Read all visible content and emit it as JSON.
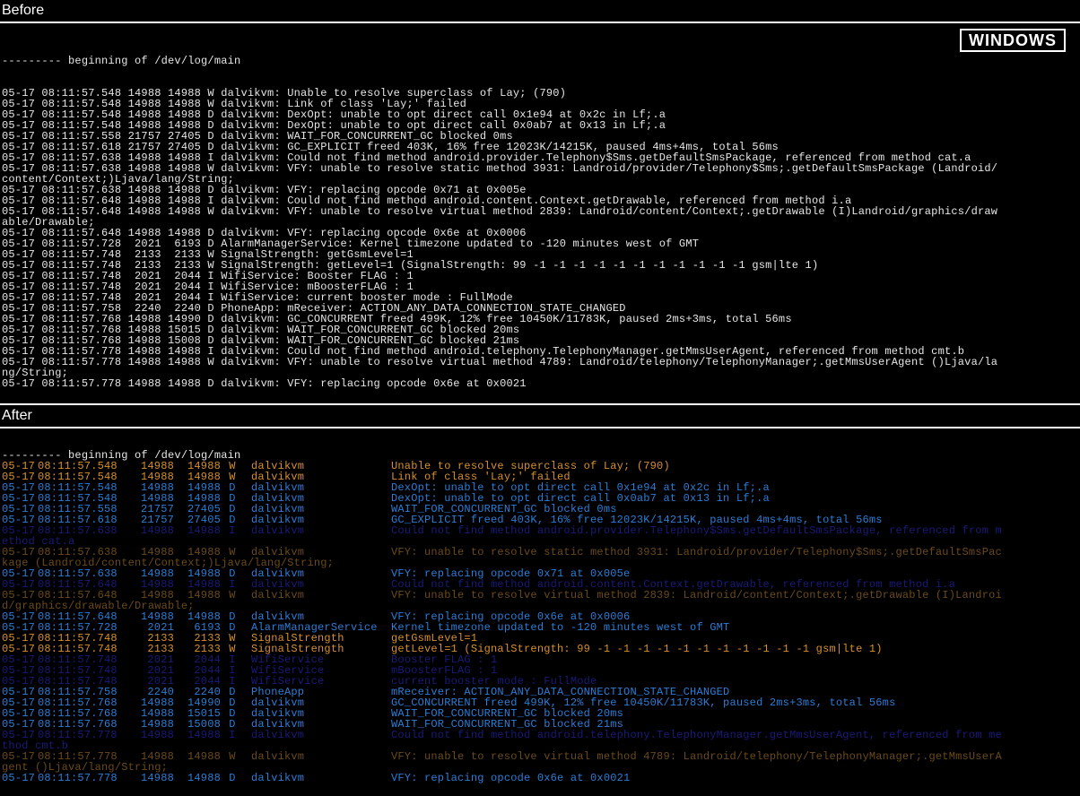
{
  "badge": "WINDOWS",
  "labels": {
    "before": "Before",
    "after": "After"
  },
  "begin_line": "--------- beginning of /dev/log/main",
  "before_lines": [
    "05-17 08:11:57.548 14988 14988 W dalvikvm: Unable to resolve superclass of Lay; (790)",
    "05-17 08:11:57.548 14988 14988 W dalvikvm: Link of class 'Lay;' failed",
    "05-17 08:11:57.548 14988 14988 D dalvikvm: DexOpt: unable to opt direct call 0x1e94 at 0x2c in Lf;.a",
    "05-17 08:11:57.548 14988 14988 D dalvikvm: DexOpt: unable to opt direct call 0x0ab7 at 0x13 in Lf;.a",
    "05-17 08:11:57.558 21757 27405 D dalvikvm: WAIT_FOR_CONCURRENT_GC blocked 0ms",
    "05-17 08:11:57.618 21757 27405 D dalvikvm: GC_EXPLICIT freed 403K, 16% free 12023K/14215K, paused 4ms+4ms, total 56ms",
    "05-17 08:11:57.638 14988 14988 I dalvikvm: Could not find method android.provider.Telephony$Sms.getDefaultSmsPackage, referenced from method cat.a",
    "05-17 08:11:57.638 14988 14988 W dalvikvm: VFY: unable to resolve static method 3931: Landroid/provider/Telephony$Sms;.getDefaultSmsPackage (Landroid/",
    "content/Context;)Ljava/lang/String;",
    "05-17 08:11:57.638 14988 14988 D dalvikvm: VFY: replacing opcode 0x71 at 0x005e",
    "05-17 08:11:57.648 14988 14988 I dalvikvm: Could not find method android.content.Context.getDrawable, referenced from method i.a",
    "05-17 08:11:57.648 14988 14988 W dalvikvm: VFY: unable to resolve virtual method 2839: Landroid/content/Context;.getDrawable (I)Landroid/graphics/draw",
    "able/Drawable;",
    "05-17 08:11:57.648 14988 14988 D dalvikvm: VFY: replacing opcode 0x6e at 0x0006",
    "05-17 08:11:57.728  2021  6193 D AlarmManagerService: Kernel timezone updated to -120 minutes west of GMT",
    "05-17 08:11:57.748  2133  2133 W SignalStrength: getGsmLevel=1",
    "05-17 08:11:57.748  2133  2133 W SignalStrength: getLevel=1 (SignalStrength: 99 -1 -1 -1 -1 -1 -1 -1 -1 -1 -1 -1 gsm|lte 1)",
    "05-17 08:11:57.748  2021  2044 I WifiService: Booster FLAG : 1",
    "05-17 08:11:57.748  2021  2044 I WifiService: mBoosterFLAG : 1",
    "05-17 08:11:57.748  2021  2044 I WifiService: current booster mode : FullMode",
    "05-17 08:11:57.758  2240  2240 D PhoneApp: mReceiver: ACTION_ANY_DATA_CONNECTION_STATE_CHANGED",
    "05-17 08:11:57.768 14988 14990 D dalvikvm: GC_CONCURRENT freed 499K, 12% free 10450K/11783K, paused 2ms+3ms, total 56ms",
    "05-17 08:11:57.768 14988 15015 D dalvikvm: WAIT_FOR_CONCURRENT_GC blocked 20ms",
    "05-17 08:11:57.768 14988 15008 D dalvikvm: WAIT_FOR_CONCURRENT_GC blocked 21ms",
    "05-17 08:11:57.778 14988 14988 I dalvikvm: Could not find method android.telephony.TelephonyManager.getMmsUserAgent, referenced from method cmt.b",
    "05-17 08:11:57.778 14988 14988 W dalvikvm: VFY: unable to resolve virtual method 4789: Landroid/telephony/TelephonyManager;.getMmsUserAgent ()Ljava/la",
    "ng/String;",
    "05-17 08:11:57.778 14988 14988 D dalvikvm: VFY: replacing opcode 0x6e at 0x0021"
  ],
  "after_rows": [
    {
      "cls": "begin",
      "text": "--------- beginning of /dev/log/main"
    },
    {
      "d": "05-17",
      "t": "08:11:57.548",
      "p1": "14988",
      "p2": "14988",
      "l": "W",
      "tag": "dalvikvm",
      "msg": "Unable to resolve superclass of Lay; (790)"
    },
    {
      "d": "05-17",
      "t": "08:11:57.548",
      "p1": "14988",
      "p2": "14988",
      "l": "W",
      "tag": "dalvikvm",
      "msg": "Link of class 'Lay;' failed"
    },
    {
      "d": "05-17",
      "t": "08:11:57.548",
      "p1": "14988",
      "p2": "14988",
      "l": "D",
      "tag": "dalvikvm",
      "msg": "DexOpt: unable to opt direct call 0x1e94 at 0x2c in Lf;.a"
    },
    {
      "d": "05-17",
      "t": "08:11:57.548",
      "p1": "14988",
      "p2": "14988",
      "l": "D",
      "tag": "dalvikvm",
      "msg": "DexOpt: unable to opt direct call 0x0ab7 at 0x13 in Lf;.a"
    },
    {
      "d": "05-17",
      "t": "08:11:57.558",
      "p1": "21757",
      "p2": "27405",
      "l": "D",
      "tag": "dalvikvm",
      "msg": "WAIT_FOR_CONCURRENT_GC blocked 0ms"
    },
    {
      "d": "05-17",
      "t": "08:11:57.618",
      "p1": "21757",
      "p2": "27405",
      "l": "D",
      "tag": "dalvikvm",
      "msg": "GC_EXPLICIT freed 403K, 16% free 12023K/14215K, paused 4ms+4ms, total 56ms"
    },
    {
      "cls": "dim",
      "d": "05-17",
      "t": "08:11:57.638",
      "p1": "14988",
      "p2": "14988",
      "l": "I",
      "tag": "dalvikvm",
      "msg": "Could not find method android.provider.Telephony$Sms.getDefaultSmsPackage, referenced from m"
    },
    {
      "cls": "dim-wrap",
      "text": "ethod cat.a"
    },
    {
      "cls": "faint",
      "d": "05-17",
      "t": "08:11:57.638",
      "p1": "14988",
      "p2": "14988",
      "l": "W",
      "tag": "dalvikvm",
      "msg": "VFY: unable to resolve static method 3931: Landroid/provider/Telephony$Sms;.getDefaultSmsPac"
    },
    {
      "cls": "faint-wrap",
      "text": "kage (Landroid/content/Context;)Ljava/lang/String;"
    },
    {
      "d": "05-17",
      "t": "08:11:57.638",
      "p1": "14988",
      "p2": "14988",
      "l": "D",
      "tag": "dalvikvm",
      "msg": "VFY: replacing opcode 0x71 at 0x005e"
    },
    {
      "cls": "dim",
      "d": "05-17",
      "t": "08:11:57.648",
      "p1": "14988",
      "p2": "14988",
      "l": "I",
      "tag": "dalvikvm",
      "msg": "Could not find method android.content.Context.getDrawable, referenced from method i.a"
    },
    {
      "cls": "faint",
      "d": "05-17",
      "t": "08:11:57.648",
      "p1": "14988",
      "p2": "14988",
      "l": "W",
      "tag": "dalvikvm",
      "msg": "VFY: unable to resolve virtual method 2839: Landroid/content/Context;.getDrawable (I)Landroi"
    },
    {
      "cls": "faint-wrap",
      "text": "d/graphics/drawable/Drawable;"
    },
    {
      "d": "05-17",
      "t": "08:11:57.648",
      "p1": "14988",
      "p2": "14988",
      "l": "D",
      "tag": "dalvikvm",
      "msg": "VFY: replacing opcode 0x6e at 0x0006"
    },
    {
      "d": "05-17",
      "t": "08:11:57.728",
      "p1": "2021",
      "p2": "6193",
      "l": "D",
      "tag": "AlarmManagerService",
      "msg": "Kernel timezone updated to -120 minutes west of GMT"
    },
    {
      "d": "05-17",
      "t": "08:11:57.748",
      "p1": "2133",
      "p2": "2133",
      "l": "W",
      "tag": "SignalStrength",
      "msg": "getGsmLevel=1"
    },
    {
      "d": "05-17",
      "t": "08:11:57.748",
      "p1": "2133",
      "p2": "2133",
      "l": "W",
      "tag": "SignalStrength",
      "msg": "getLevel=1 (SignalStrength: 99 -1 -1 -1 -1 -1 -1 -1 -1 -1 -1 -1 gsm|lte 1)"
    },
    {
      "cls": "dim",
      "d": "05-17",
      "t": "08:11:57.748",
      "p1": "2021",
      "p2": "2044",
      "l": "I",
      "tag": "WifiService",
      "msg": "Booster FLAG : 1"
    },
    {
      "cls": "dim",
      "d": "05-17",
      "t": "08:11:57.748",
      "p1": "2021",
      "p2": "2044",
      "l": "I",
      "tag": "WifiService",
      "msg": "mBoosterFLAG : 1"
    },
    {
      "cls": "dim",
      "d": "05-17",
      "t": "08:11:57.748",
      "p1": "2021",
      "p2": "2044",
      "l": "I",
      "tag": "WifiService",
      "msg": "current booster mode : FullMode"
    },
    {
      "d": "05-17",
      "t": "08:11:57.758",
      "p1": "2240",
      "p2": "2240",
      "l": "D",
      "tag": "PhoneApp",
      "msg": "mReceiver: ACTION_ANY_DATA_CONNECTION_STATE_CHANGED"
    },
    {
      "d": "05-17",
      "t": "08:11:57.768",
      "p1": "14988",
      "p2": "14990",
      "l": "D",
      "tag": "dalvikvm",
      "msg": "GC_CONCURRENT freed 499K, 12% free 10450K/11783K, paused 2ms+3ms, total 56ms"
    },
    {
      "d": "05-17",
      "t": "08:11:57.768",
      "p1": "14988",
      "p2": "15015",
      "l": "D",
      "tag": "dalvikvm",
      "msg": "WAIT_FOR_CONCURRENT_GC blocked 20ms"
    },
    {
      "d": "05-17",
      "t": "08:11:57.768",
      "p1": "14988",
      "p2": "15008",
      "l": "D",
      "tag": "dalvikvm",
      "msg": "WAIT_FOR_CONCURRENT_GC blocked 21ms"
    },
    {
      "cls": "dim",
      "d": "05-17",
      "t": "08:11:57.778",
      "p1": "14988",
      "p2": "14988",
      "l": "I",
      "tag": "dalvikvm",
      "msg": "Could not find method android.telephony.TelephonyManager.getMmsUserAgent, referenced from me"
    },
    {
      "cls": "dim-wrap",
      "text": "thod cmt.b"
    },
    {
      "cls": "faint",
      "d": "05-17",
      "t": "08:11:57.778",
      "p1": "14988",
      "p2": "14988",
      "l": "W",
      "tag": "dalvikvm",
      "msg": "VFY: unable to resolve virtual method 4789: Landroid/telephony/TelephonyManager;.getMmsUserA"
    },
    {
      "cls": "faint-wrap",
      "text": "gent ()Ljava/lang/String;"
    },
    {
      "d": "05-17",
      "t": "08:11:57.778",
      "p1": "14988",
      "p2": "14988",
      "l": "D",
      "tag": "dalvikvm",
      "msg": "VFY: replacing opcode 0x6e at 0x0021"
    }
  ]
}
